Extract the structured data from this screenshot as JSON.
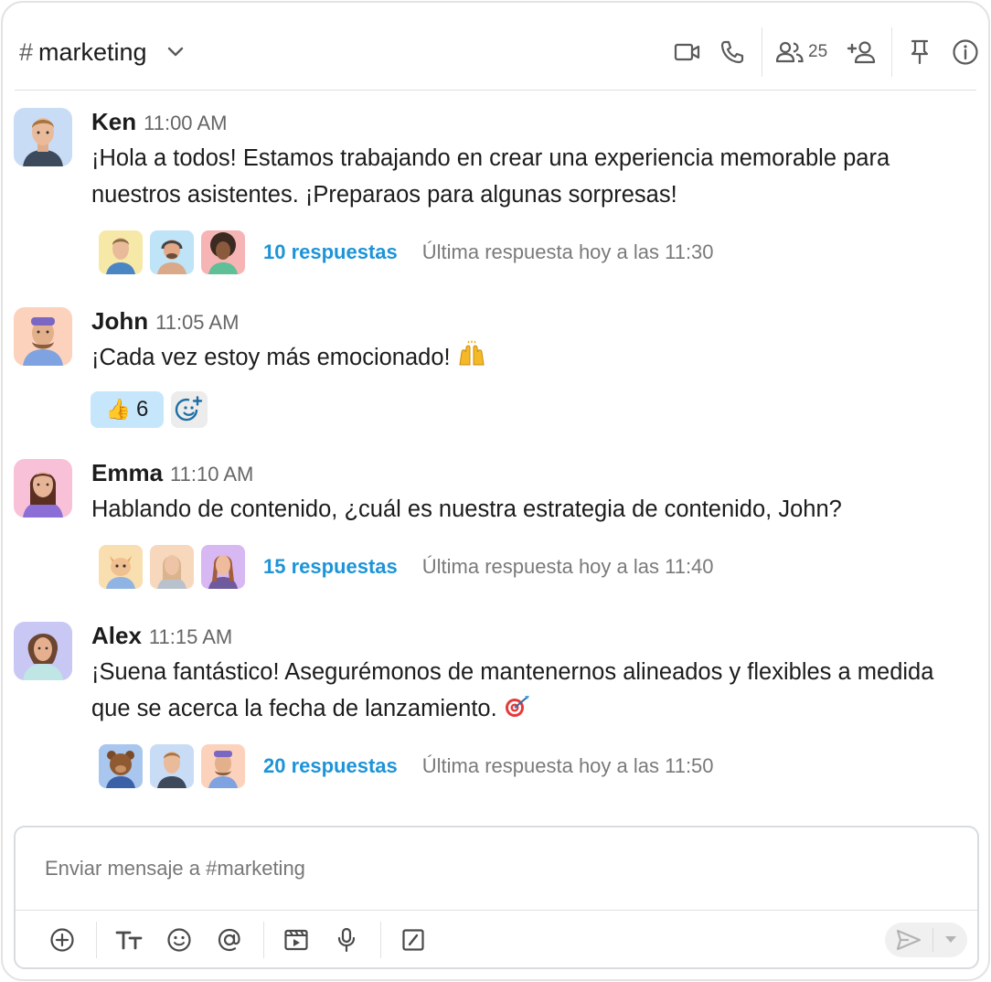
{
  "header": {
    "hash": "#",
    "channel_name": "marketing",
    "member_count": "25",
    "icons": [
      "chevron-down-icon",
      "video-icon",
      "phone-icon",
      "members-icon",
      "add-member-icon",
      "pin-icon",
      "info-icon"
    ]
  },
  "messages": [
    {
      "author": "Ken",
      "time": "11:00 AM",
      "text": "¡Hola a todos! Estamos trabajando en crear una experiencia memorable para nuestros asistentes. ¡Preparaos para algunas sorpresas!",
      "thread": {
        "replies": "10 respuestas",
        "last_reply": "Última respuesta hoy a las 11:30"
      }
    },
    {
      "author": "John",
      "time": "11:05 AM",
      "text": "¡Cada vez estoy más emocionado!",
      "emoji": "raising-hands",
      "reactions": [
        {
          "emoji": "👍",
          "count": "6"
        }
      ]
    },
    {
      "author": "Emma",
      "time": "11:10 AM",
      "text": "Hablando de contenido, ¿cuál es nuestra estrategia de contenido, John?",
      "thread": {
        "replies": "15 respuestas",
        "last_reply": "Última respuesta hoy a las 11:40"
      }
    },
    {
      "author": "Alex",
      "time": "11:15 AM",
      "text": "¡Suena fantástico! Asegurémonos de mantenernos alineados y flexibles a medida que se acerca la fecha de lanzamiento.",
      "emoji": "direct-hit",
      "thread": {
        "replies": "20 respuestas",
        "last_reply": "Última respuesta hoy a las 11:50"
      }
    }
  ],
  "composer": {
    "placeholder": "Enviar mensaje a #marketing",
    "tools": [
      "plus-circle-icon",
      "text-format-icon",
      "emoji-icon",
      "mention-icon",
      "video-clip-icon",
      "microphone-icon",
      "slash-command-icon",
      "send-icon",
      "send-options-chevron-icon"
    ]
  },
  "colors": {
    "link": "#1e94d6",
    "reaction_bg": "#c6e7fb",
    "border": "#d8dcdf"
  }
}
